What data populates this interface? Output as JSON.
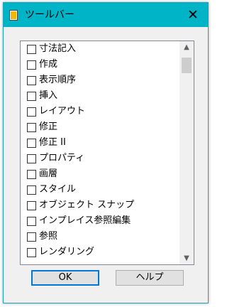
{
  "window": {
    "title": "ツールバー",
    "close_label": "✕"
  },
  "list": {
    "items": [
      {
        "label": "寸法記入",
        "checked": false
      },
      {
        "label": "作成",
        "checked": false
      },
      {
        "label": "表示順序",
        "checked": false
      },
      {
        "label": "挿入",
        "checked": false
      },
      {
        "label": "レイアウト",
        "checked": false
      },
      {
        "label": "修正",
        "checked": false
      },
      {
        "label": "修正 II",
        "checked": false
      },
      {
        "label": "プロパティ",
        "checked": false
      },
      {
        "label": "画層",
        "checked": false
      },
      {
        "label": "スタイル",
        "checked": false
      },
      {
        "label": "オブジェクト スナップ",
        "checked": false
      },
      {
        "label": "インプレイス参照編集",
        "checked": false
      },
      {
        "label": "参照",
        "checked": false
      },
      {
        "label": "レンダリング",
        "checked": false
      }
    ],
    "scroll_up": "⌃",
    "scroll_down": "⌄"
  },
  "buttons": {
    "ok": "OK",
    "help": "ヘルプ"
  },
  "colors": {
    "titlebar": "#00b4c8",
    "accent": "#0078d7"
  }
}
